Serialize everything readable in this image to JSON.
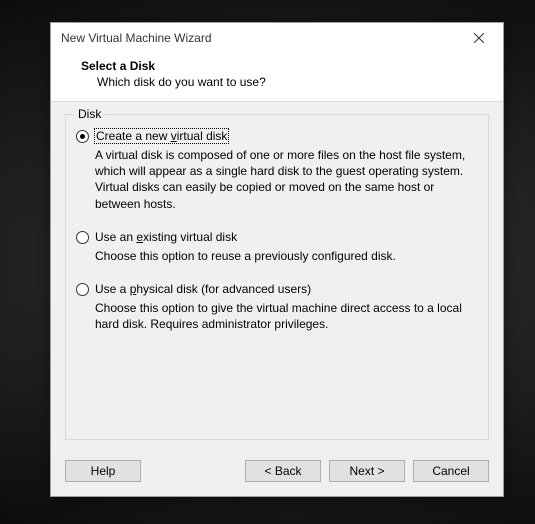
{
  "window": {
    "title": "New Virtual Machine Wizard"
  },
  "header": {
    "title": "Select a Disk",
    "subtitle": "Which disk do you want to use?"
  },
  "group": {
    "legend": "Disk"
  },
  "options": {
    "create": {
      "pre": "Create a new ",
      "mn": "v",
      "post": "irtual disk",
      "desc": "A virtual disk is composed of one or more files on the host file system, which will appear as a single hard disk to the guest operating system. Virtual disks can easily be copied or moved on the same host or between hosts."
    },
    "existing": {
      "pre": "Use an ",
      "mn": "e",
      "post": "xisting virtual disk",
      "desc": "Choose this option to reuse a previously configured disk."
    },
    "physical": {
      "pre": "Use a ",
      "mn": "p",
      "post": "hysical disk (for advanced users)",
      "desc": "Choose this option to give the virtual machine direct access to a local hard disk. Requires administrator privileges."
    }
  },
  "buttons": {
    "help": "Help",
    "back": "< Back",
    "next": "Next >",
    "cancel": "Cancel"
  }
}
